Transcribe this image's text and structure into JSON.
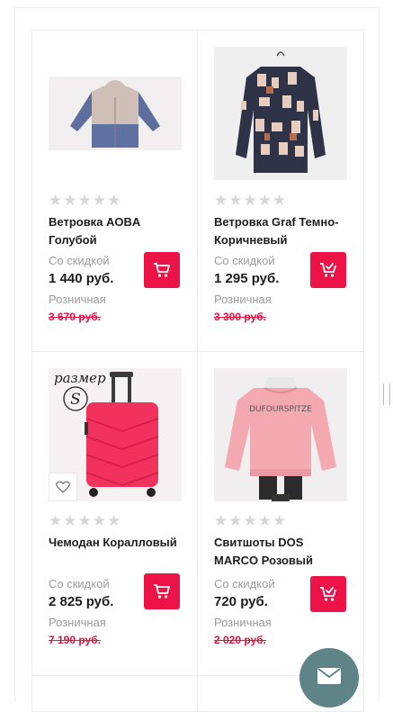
{
  "products": [
    {
      "title": "Ветровка AOBA Голубой",
      "discount_label": "Со скидкой",
      "price": "1 440 руб.",
      "retail_label": "Розничная",
      "old_price": "3 670 руб.",
      "cart_icon": "cart-icon",
      "rating": 0
    },
    {
      "title": "Ветровка Graf Темно-Коричневый",
      "discount_label": "Со скидкой",
      "price": "1 295 руб.",
      "retail_label": "Розничная",
      "old_price": "3 300 руб.",
      "cart_icon": "cart-added-icon",
      "rating": 0
    },
    {
      "title": "Чемодан Коралловый",
      "discount_label": "Со скидкой",
      "price": "2 825 руб.",
      "retail_label": "Розничная",
      "old_price": "7 190 руб.",
      "cart_icon": "cart-icon",
      "image_caption": "размер",
      "size_letter": "S",
      "rating": 0
    },
    {
      "title": "Свитшоты DOS MARCO Розовый",
      "discount_label": "Со скидкой",
      "price": "720 руб.",
      "retail_label": "Розничная",
      "old_price": "2 020 руб.",
      "cart_icon": "cart-added-icon",
      "image_text": "DUFOURSPITZE",
      "rating": 0
    }
  ],
  "colors": {
    "accent": "#ee1346",
    "old_price": "#e3133f",
    "muted_text": "#9a9a9a",
    "star_empty": "#d6d6d6",
    "mail_button": "#5e8487"
  },
  "floating": {
    "mail_icon": "mail-icon"
  }
}
